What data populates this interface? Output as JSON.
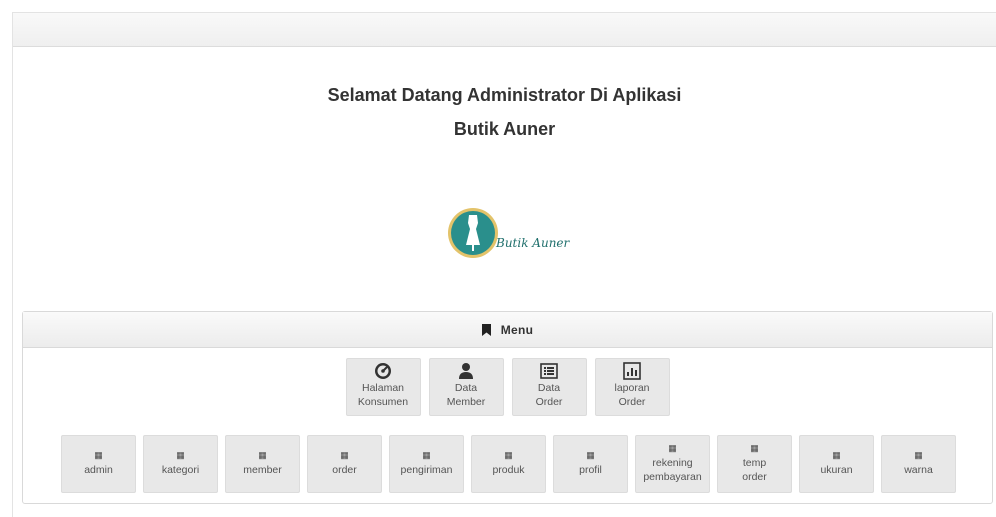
{
  "welcome": {
    "line1": "Selamat Datang Administrator Di Aplikasi",
    "line2": "Butik Auner"
  },
  "logo": {
    "text": "Butik Auner",
    "colors": {
      "circle": "#2a8f8c",
      "ring": "#e3c36a",
      "text": "#1f6f6c"
    }
  },
  "menu": {
    "title": "Menu",
    "primary": [
      {
        "l1": "Halaman",
        "l2": "Konsumen",
        "icon": "dashboard-icon"
      },
      {
        "l1": "Data",
        "l2": "Member",
        "icon": "user-icon"
      },
      {
        "l1": "Data",
        "l2": "Order",
        "icon": "list-icon"
      },
      {
        "l1": "laporan",
        "l2": "Order",
        "icon": "bar-chart-icon"
      }
    ],
    "tables": [
      {
        "l1": "admin",
        "l2": ""
      },
      {
        "l1": "kategori",
        "l2": ""
      },
      {
        "l1": "member",
        "l2": ""
      },
      {
        "l1": "order",
        "l2": ""
      },
      {
        "l1": "pengiriman",
        "l2": ""
      },
      {
        "l1": "produk",
        "l2": ""
      },
      {
        "l1": "profil",
        "l2": ""
      },
      {
        "l1": "rekening",
        "l2": "pembayaran"
      },
      {
        "l1": "temp",
        "l2": "order"
      },
      {
        "l1": "ukuran",
        "l2": ""
      },
      {
        "l1": "warna",
        "l2": ""
      }
    ],
    "table_icon": "table-icon"
  }
}
